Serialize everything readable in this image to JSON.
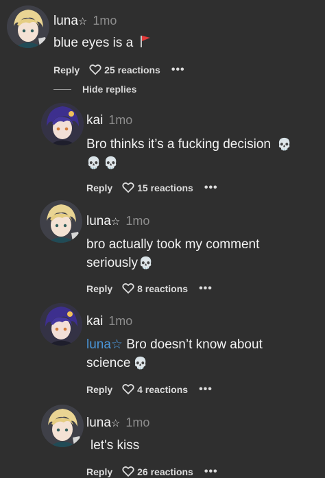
{
  "colors": {
    "background": "#2f2f2f",
    "mention": "#4a95d8",
    "time": "#8d8d8d"
  },
  "hide_replies_label": "Hide replies",
  "comments": [
    {
      "username": "luna",
      "star": "☆",
      "time": "1mo",
      "text": "blue eyes is a",
      "emoji": "red-flag",
      "reply_label": "Reply",
      "reactions": "25 reactions",
      "more": "•••"
    },
    {
      "username": "kai",
      "time": "1mo",
      "text": "Bro thinks it’s a fucking decision",
      "emoji_icons": [
        "skull-icon",
        "skull-icon",
        "skull-icon"
      ],
      "reply_label": "Reply",
      "reactions": "15 reactions",
      "more": "•••"
    },
    {
      "username": "luna",
      "star": "☆",
      "time": "1mo",
      "text": "bro actually took my comment seriously",
      "emoji_icons": [
        "skull-icon"
      ],
      "reply_label": "Reply",
      "reactions": "8 reactions",
      "more": "•••"
    },
    {
      "username": "kai",
      "time": "1mo",
      "mention": "luna☆",
      "text": "Bro doesn’t know about science",
      "emoji_icons": [
        "skull-icon"
      ],
      "reply_label": "Reply",
      "reactions": "4 reactions",
      "more": "•••"
    },
    {
      "username": "luna",
      "star": "☆",
      "time": "1mo",
      "text": "let's kiss",
      "reply_label": "Reply",
      "reactions": "26 reactions",
      "more": "•••"
    }
  ]
}
